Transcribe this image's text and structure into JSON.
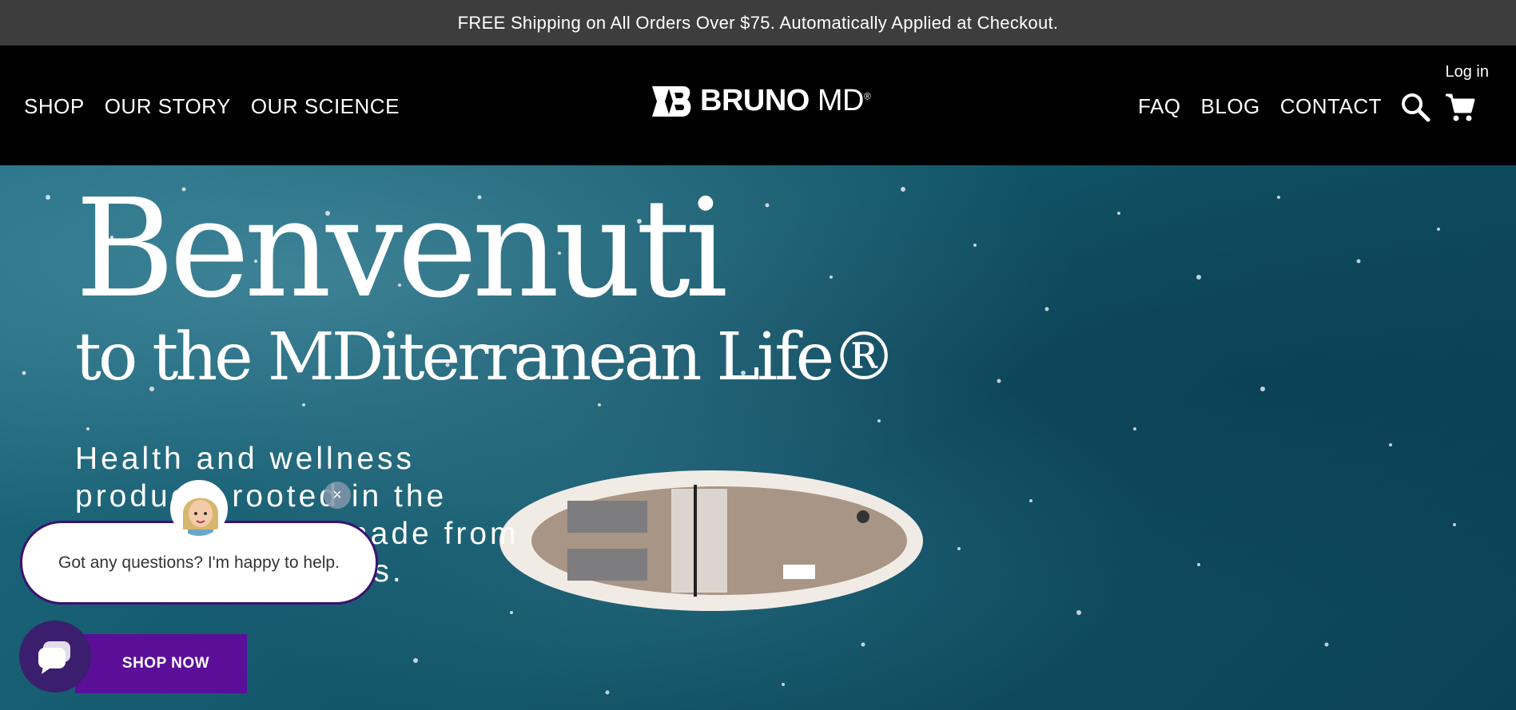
{
  "announcement": {
    "text": "FREE Shipping on All Orders Over $75. Automatically Applied at Checkout."
  },
  "header": {
    "nav_left": [
      "SHOP",
      "OUR STORY",
      "OUR SCIENCE"
    ],
    "nav_right": [
      "FAQ",
      "BLOG",
      "CONTACT"
    ],
    "login_label": "Log in",
    "logo": {
      "brand": "BRUNO",
      "suffix": "MD",
      "mark": "®"
    },
    "icons": {
      "search": "search-icon",
      "cart": "cart-icon"
    }
  },
  "hero": {
    "title": "Benvenuti",
    "subtitle": "to the MDiterranean Life®",
    "description": "Health and wellness products rooted in the Mediterranean, made from natural ingredients.",
    "cta_label": "SHOP NOW"
  },
  "chat": {
    "message": "Got any questions? I'm happy to help.",
    "close_label": "×",
    "icons": {
      "launcher": "chat-icon",
      "avatar": "assistant-avatar"
    }
  },
  "colors": {
    "announcement_bg": "#3d3d3d",
    "header_bg": "#000000",
    "cta_bg": "#5b0f99",
    "chat_border": "#3b1170",
    "chat_launcher_bg": "#3b1e6e"
  }
}
